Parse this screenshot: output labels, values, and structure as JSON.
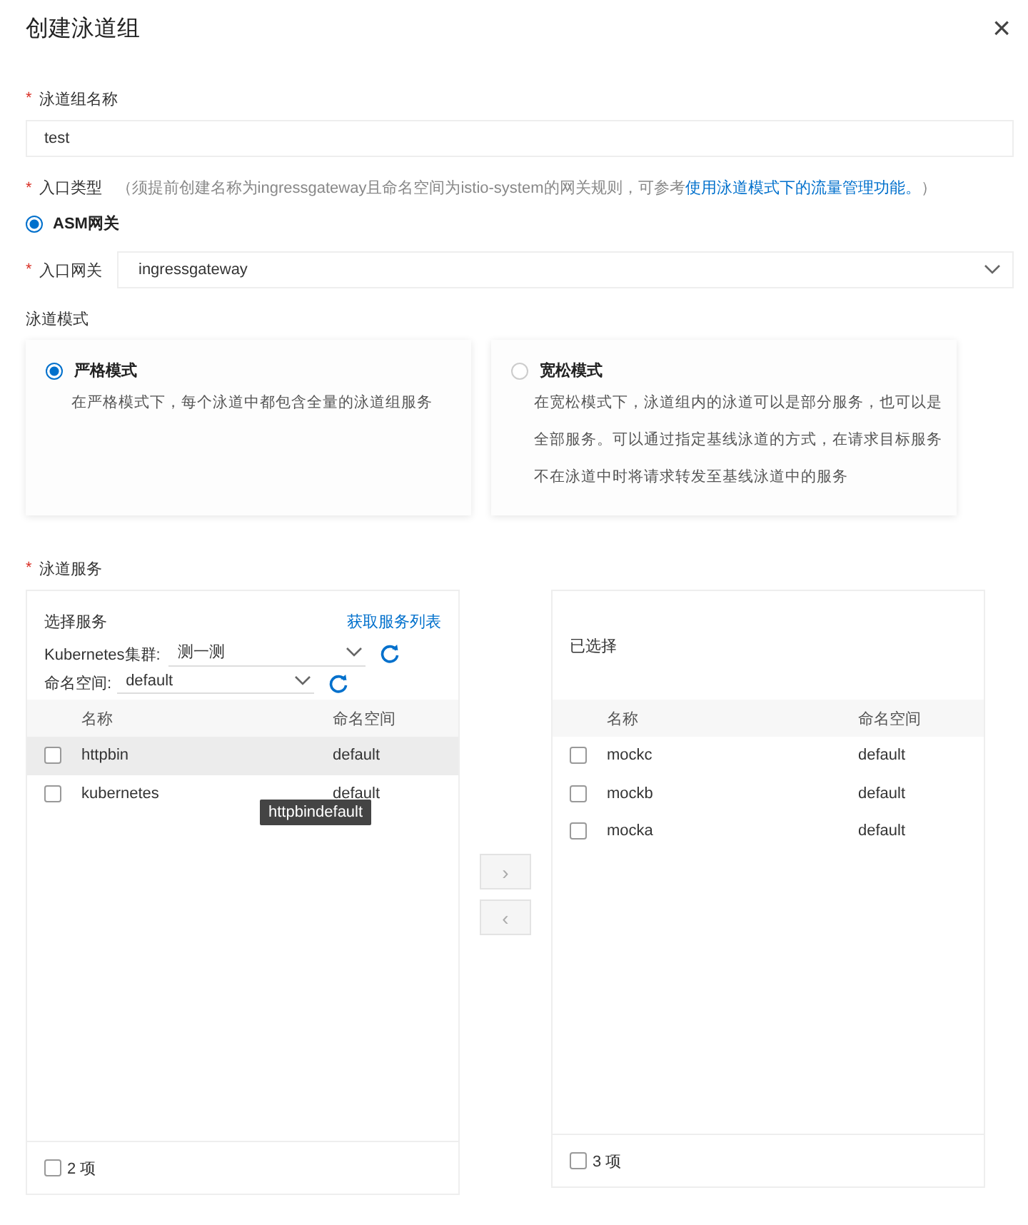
{
  "dialog": {
    "title": "创建泳道组",
    "close": "×"
  },
  "name_field": {
    "label": "泳道组名称",
    "required_mark": "*",
    "value": "test"
  },
  "entry_type": {
    "label": "入口类型",
    "required_mark": "*",
    "hint": "（须提前创建名称为ingressgateway且命名空间为istio-system的网关规则，可参考",
    "link": "使用泳道模式下的流量管理功能。",
    "hint_end": "）",
    "options": [
      {
        "label": "ASM网关",
        "selected": true
      }
    ]
  },
  "gateway": {
    "label": "入口网关",
    "required_mark": "*",
    "value": "ingressgateway"
  },
  "mode": {
    "label": "泳道模式",
    "options": [
      {
        "title": "严格模式",
        "selected": true,
        "description": "在严格模式下，每个泳道中都包含全量的泳道组服务"
      },
      {
        "title": "宽松模式",
        "selected": false,
        "description": "在宽松模式下，泳道组内的泳道可以是部分服务，也可以是全部服务。可以通过指定基线泳道的方式，在请求目标服务不在泳道中时将请求转发至基线泳道中的服务"
      }
    ]
  },
  "services": {
    "label": "泳道服务",
    "required_mark": "*",
    "source": {
      "title": "选择服务",
      "link": "获取服务列表",
      "cluster_label": "Kubernetes集群:",
      "cluster_value": "测一测",
      "namespace_label": "命名空间:",
      "namespace_value": "default",
      "columns": [
        "名称",
        "命名空间"
      ],
      "rows": [
        {
          "name": "httpbin",
          "namespace": "default",
          "checked": false,
          "highlighted": true
        },
        {
          "name": "kubernetes",
          "namespace": "default",
          "checked": false,
          "highlighted": false
        }
      ],
      "tooltip": "httpbindefault",
      "footer": "2 项",
      "footer_checked": false
    },
    "move_buttons": [
      {
        "label": "›",
        "disabled": true
      },
      {
        "label": "‹",
        "disabled": true
      }
    ],
    "target": {
      "title": "已选择",
      "columns": [
        "名称",
        "命名空间"
      ],
      "rows": [
        {
          "name": "mockc",
          "namespace": "default",
          "checked": false,
          "highlighted": false
        },
        {
          "name": "mockb",
          "namespace": "default",
          "checked": false,
          "highlighted": false
        },
        {
          "name": "mocka",
          "namespace": "default",
          "checked": false,
          "highlighted": false
        }
      ],
      "footer": "3 项",
      "footer_checked": false
    }
  }
}
